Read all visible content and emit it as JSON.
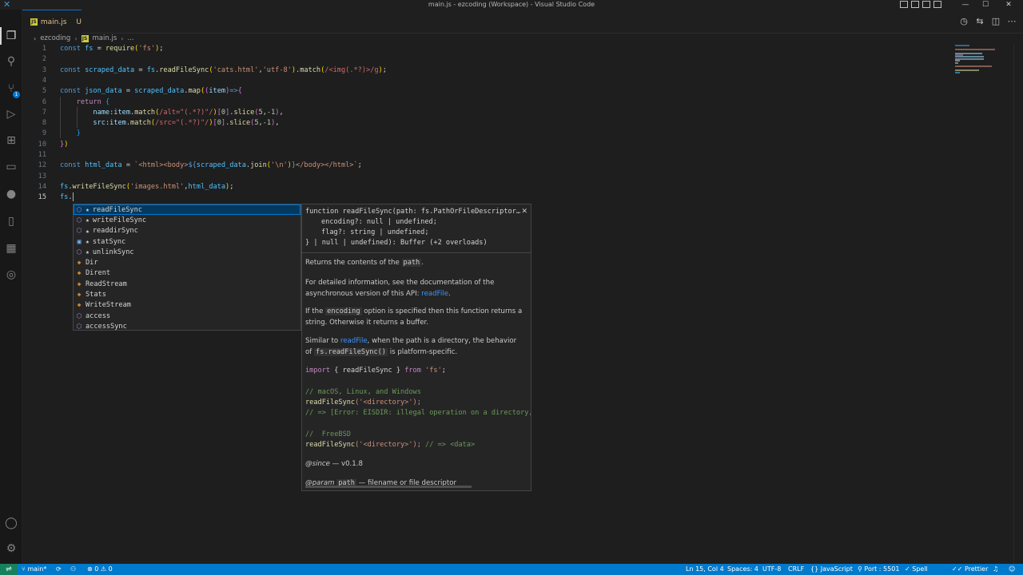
{
  "window": {
    "title": "main.js - ezcoding (Workspace) - Visual Studio Code",
    "controls": {
      "minimize": "—",
      "maximize": "☐",
      "close": "✕"
    }
  },
  "activity_bar": {
    "icons": [
      "explorer-icon",
      "search-icon",
      "source-control-icon",
      "run-debug-icon",
      "extensions-icon",
      "remote-explorer-icon",
      "github-icon",
      "bookmarks-icon",
      "docker-icon",
      "gitlens-icon",
      "account-icon",
      "settings-gear-icon"
    ],
    "badge": "1"
  },
  "tab": {
    "icon": "JS",
    "name": "main.js",
    "status": "U"
  },
  "breadcrumb": {
    "folder": "ezcoding",
    "file": "main.js",
    "more": "..."
  },
  "editor": {
    "line_numbers": [
      "1",
      "2",
      "3",
      "4",
      "5",
      "6",
      "7",
      "8",
      "9",
      "10",
      "11",
      "12",
      "13",
      "14",
      "15"
    ],
    "current_line": "15",
    "code": [
      [
        [
          "kw",
          "const"
        ],
        [
          "pun",
          " "
        ],
        [
          "var",
          "fs"
        ],
        [
          "pun",
          " = "
        ],
        [
          "fn",
          "require"
        ],
        [
          "br1",
          "("
        ],
        [
          "str",
          "'fs'"
        ],
        [
          "br1",
          ")"
        ],
        [
          "pun",
          ";"
        ]
      ],
      [],
      [
        [
          "kw",
          "const"
        ],
        [
          "pun",
          " "
        ],
        [
          "var",
          "scraped_data"
        ],
        [
          "pun",
          " = "
        ],
        [
          "var",
          "fs"
        ],
        [
          "pun",
          "."
        ],
        [
          "fn",
          "readFileSync"
        ],
        [
          "br1",
          "("
        ],
        [
          "str",
          "'cats.html'"
        ],
        [
          "pun",
          ","
        ],
        [
          "str",
          "'utf-8'"
        ],
        [
          "br1",
          ")"
        ],
        [
          "pun",
          "."
        ],
        [
          "fn",
          "match"
        ],
        [
          "br1",
          "("
        ],
        [
          "re",
          "/<img(.*?)>/g"
        ],
        [
          "br1",
          ")"
        ],
        [
          "pun",
          ";"
        ]
      ],
      [],
      [
        [
          "kw",
          "const"
        ],
        [
          "pun",
          " "
        ],
        [
          "var",
          "json_data"
        ],
        [
          "pun",
          " = "
        ],
        [
          "var",
          "scraped_data"
        ],
        [
          "pun",
          "."
        ],
        [
          "fn",
          "map"
        ],
        [
          "br1",
          "("
        ],
        [
          "br2",
          "("
        ],
        [
          "prop",
          "item"
        ],
        [
          "br2",
          ")"
        ],
        [
          "kw",
          "=>"
        ],
        [
          "br2",
          "{"
        ]
      ],
      [
        [
          "pun",
          "    "
        ],
        [
          "kw2",
          "return"
        ],
        [
          "pun",
          " "
        ],
        [
          "br3",
          "{"
        ]
      ],
      [
        [
          "pun",
          "        "
        ],
        [
          "prop",
          "name"
        ],
        [
          "pun",
          ":"
        ],
        [
          "prop",
          "item"
        ],
        [
          "pun",
          "."
        ],
        [
          "fn",
          "match"
        ],
        [
          "br1",
          "("
        ],
        [
          "re",
          "/alt=\"(.*?)\"/"
        ],
        [
          "br1",
          ")"
        ],
        [
          "br2",
          "["
        ],
        [
          "num",
          "0"
        ],
        [
          "br2",
          "]"
        ],
        [
          "pun",
          "."
        ],
        [
          "fn",
          "slice"
        ],
        [
          "br2",
          "("
        ],
        [
          "num",
          "5"
        ],
        [
          "pun",
          ","
        ],
        [
          "num",
          "-1"
        ],
        [
          "br2",
          ")"
        ],
        [
          "pun",
          ","
        ]
      ],
      [
        [
          "pun",
          "        "
        ],
        [
          "prop",
          "src"
        ],
        [
          "pun",
          ":"
        ],
        [
          "prop",
          "item"
        ],
        [
          "pun",
          "."
        ],
        [
          "fn",
          "match"
        ],
        [
          "br1",
          "("
        ],
        [
          "re",
          "/src=\"(.*?)\"/"
        ],
        [
          "br1",
          ")"
        ],
        [
          "br2",
          "["
        ],
        [
          "num",
          "0"
        ],
        [
          "br2",
          "]"
        ],
        [
          "pun",
          "."
        ],
        [
          "fn",
          "slice"
        ],
        [
          "br2",
          "("
        ],
        [
          "num",
          "5"
        ],
        [
          "pun",
          ","
        ],
        [
          "num",
          "-1"
        ],
        [
          "br2",
          ")"
        ],
        [
          "pun",
          ","
        ]
      ],
      [
        [
          "pun",
          "    "
        ],
        [
          "br3",
          "}"
        ]
      ],
      [
        [
          "br2",
          "}"
        ],
        [
          "br1",
          ")"
        ]
      ],
      [],
      [
        [
          "kw",
          "const"
        ],
        [
          "pun",
          " "
        ],
        [
          "var",
          "html_data"
        ],
        [
          "pun",
          " = "
        ],
        [
          "str",
          "`<html><body>"
        ],
        [
          "kw",
          "${"
        ],
        [
          "var",
          "scraped_data"
        ],
        [
          "pun",
          "."
        ],
        [
          "fn",
          "join"
        ],
        [
          "br1",
          "("
        ],
        [
          "str",
          "'\\n'"
        ],
        [
          "br1",
          ")"
        ],
        [
          "kw",
          "}"
        ],
        [
          "str",
          "</body></html>`"
        ],
        [
          "pun",
          ";"
        ]
      ],
      [],
      [
        [
          "var",
          "fs"
        ],
        [
          "pun",
          "."
        ],
        [
          "fn",
          "writeFileSync"
        ],
        [
          "br1",
          "("
        ],
        [
          "str",
          "'images.html'"
        ],
        [
          "pun",
          ","
        ],
        [
          "var",
          "html_data"
        ],
        [
          "br1",
          ")"
        ],
        [
          "pun",
          ";"
        ]
      ],
      [
        [
          "var",
          "fs"
        ],
        [
          "pun",
          "."
        ]
      ]
    ]
  },
  "suggestions": [
    {
      "label": "readFileSync",
      "kind": "method",
      "icon": "method-icon",
      "star": "★",
      "selected": true
    },
    {
      "label": "writeFileSync",
      "kind": "method",
      "icon": "method-icon",
      "star": "★",
      "selected": false
    },
    {
      "label": "readdirSync",
      "kind": "method",
      "icon": "method-icon",
      "star": "★",
      "selected": false
    },
    {
      "label": "statSync",
      "kind": "variable",
      "icon": "variable-icon",
      "star": "★",
      "selected": false
    },
    {
      "label": "unlinkSync",
      "kind": "method",
      "icon": "method-icon",
      "star": "★",
      "selected": false
    },
    {
      "label": "Dir",
      "kind": "class",
      "icon": "class-icon",
      "star": "",
      "selected": false
    },
    {
      "label": "Dirent",
      "kind": "class",
      "icon": "class-icon",
      "star": "",
      "selected": false
    },
    {
      "label": "ReadStream",
      "kind": "class",
      "icon": "class-icon",
      "star": "",
      "selected": false
    },
    {
      "label": "Stats",
      "kind": "class",
      "icon": "class-icon",
      "star": "",
      "selected": false
    },
    {
      "label": "WriteStream",
      "kind": "class",
      "icon": "class-icon",
      "star": "",
      "selected": false
    },
    {
      "label": "access",
      "kind": "method",
      "icon": "method-icon",
      "star": "",
      "selected": false
    },
    {
      "label": "accessSync",
      "kind": "method",
      "icon": "method-icon",
      "star": "",
      "selected": false
    }
  ],
  "doc": {
    "signature": [
      "function readFileSync(path: fs.PathOrFileDescriptor…",
      "encoding?: null | undefined;",
      "flag?: string | undefined;",
      "} | null | undefined): Buffer (+2 overloads)"
    ],
    "close": "✕",
    "p1_pre": "Returns the contents of the ",
    "p1_code": "path",
    "p1_post": ".",
    "p2_line1": "For detailed information, see the documentation of the",
    "p2_line2_pre": "asynchronous version of this API: ",
    "p2_link": "readFile",
    "p2_line2_post": ".",
    "p3_pre": "If the ",
    "p3_code": "encoding",
    "p3_post": " option is specified then this function returns a",
    "p3_line2": "string. Otherwise it returns a buffer.",
    "p4_pre": "Similar to ",
    "p4_link": "readFile",
    "p4_post": ", when the path is a directory, the behavior",
    "p4_line2_pre": "of ",
    "p4_code": "fs.readFileSync()",
    "p4_line2_post": " is platform-specific.",
    "ex_import_kw": "import",
    "ex_import_mid": " { readFileSync } ",
    "ex_from_kw": "from",
    "ex_module": " 'fs'",
    "ex_import_end": ";",
    "ex_c1": "// macOS, Linux, and Windows",
    "ex_l1_fn": "readFileSync",
    "ex_l1_arg": "('<directory>');",
    "ex_c2": "// => [Error: EISDIR: illegal operation on a directory,",
    "ex_c3": "//  FreeBSD",
    "ex_l2_fn": "readFileSync",
    "ex_l2_arg": "('<directory>'); ",
    "ex_l2_cm": "// => <data>",
    "since_tag": "@since",
    "since_val": " — v0.1.8",
    "param_tag": "@param",
    "param_name": "path",
    "param_desc": " — filename or file descriptor"
  },
  "status": {
    "remote": "⇌",
    "branch": "main*",
    "sync": "⟳",
    "errors": "⊗ 0",
    "warnings": "⚠ 0",
    "position": "Ln 15, Col 4",
    "spaces": "Spaces: 4",
    "encoding": "UTF-8",
    "eol": "CRLF",
    "language": "{} JavaScript",
    "port": "Port : 5501",
    "spell": "Spell",
    "prettier": "Prettier",
    "colors": {
      "bar": "#007acc",
      "remote": "#16825d"
    }
  }
}
